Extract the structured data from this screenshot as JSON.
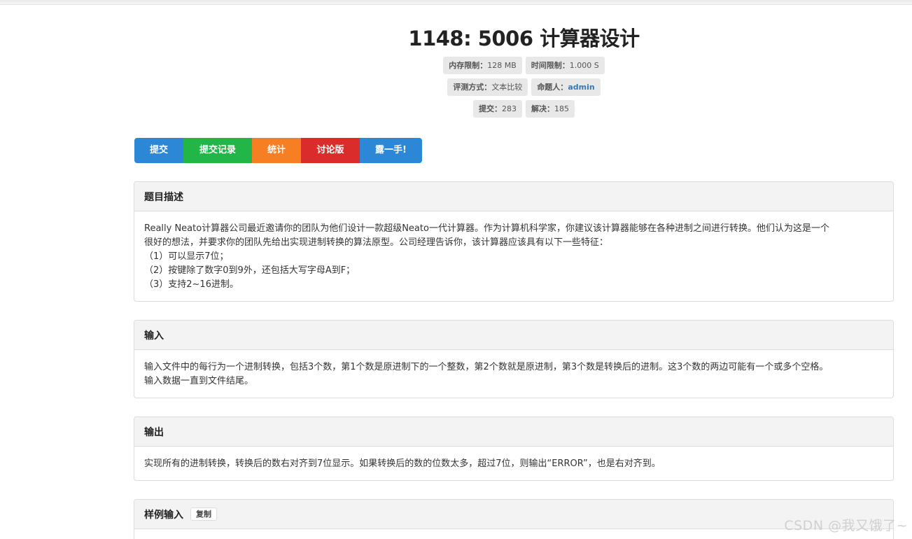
{
  "problem": {
    "title": "1148: 5006 计算器设计",
    "meta_rows": [
      [
        {
          "label": "内存限制：",
          "value": "128 MB"
        },
        {
          "label": "时间限制：",
          "value": "1.000 S"
        }
      ],
      [
        {
          "label": "评测方式：",
          "value": "文本比较"
        },
        {
          "label": "命题人：",
          "value": "admin",
          "link": true
        }
      ],
      [
        {
          "label": "提交：",
          "value": "283"
        },
        {
          "label": "解决：",
          "value": "185"
        }
      ]
    ]
  },
  "actions": [
    {
      "label": "提交",
      "color": "#2c87d6"
    },
    {
      "label": "提交记录",
      "color": "#22b548"
    },
    {
      "label": "统计",
      "color": "#f67e23"
    },
    {
      "label": "讨论版",
      "color": "#db2c2c"
    },
    {
      "label": "露一手!",
      "color": "#2c87d6"
    }
  ],
  "sections": {
    "description": {
      "title": "题目描述",
      "lines": [
        "Really Neato计算器公司最近邀请你的团队为他们设计一款超级Neato一代计算器。作为计算机科学家，你建议该计算器能够在各种进制之间进行转换。他们认为这是一个",
        "很好的想法，并要求你的团队先给出实现进制转换的算法原型。公司经理告诉你，该计算器应该具有以下一些特征：",
        "（1）可以显示7位；",
        "（2）按键除了数字0到9外，还包括大写字母A到F；",
        "（3）支持2~16进制。"
      ]
    },
    "input": {
      "title": "输入",
      "lines": [
        "输入文件中的每行为一个进制转换，包括3个数，第1个数是原进制下的一个整数，第2个数就是原进制，第3个数是转换后的进制。这3个数的两边可能有一个或多个空格。",
        "输入数据一直到文件结尾。"
      ]
    },
    "output": {
      "title": "输出",
      "lines": [
        "实现所有的进制转换，转换后的数右对齐到7位显示。如果转换后的数的位数太多，超过7位，则输出“ERROR”，也是右对齐到。"
      ]
    },
    "sample_input": {
      "title": "样例输入",
      "copy_label": "复制"
    }
  },
  "watermark": "CSDN @我又饿了~"
}
